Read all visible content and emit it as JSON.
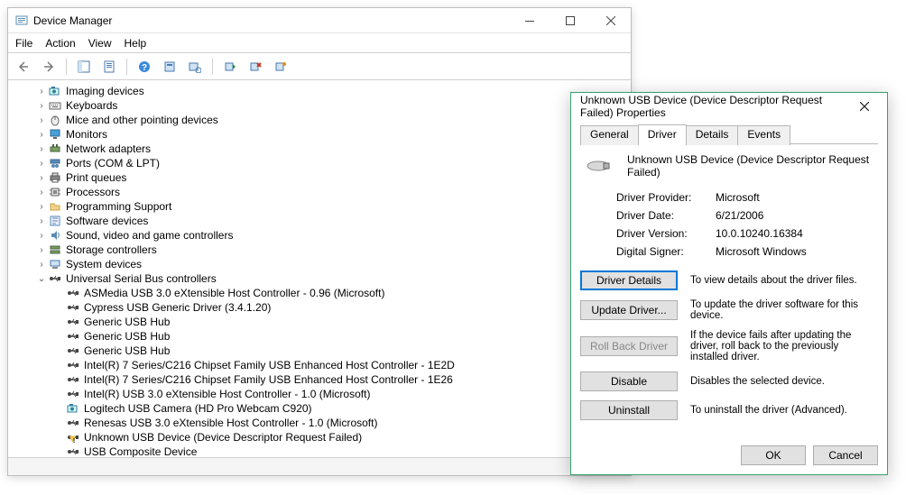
{
  "devmgr": {
    "title": "Device Manager",
    "menu": {
      "file": "File",
      "action": "Action",
      "view": "View",
      "help": "Help"
    },
    "tree": [
      {
        "indent": 1,
        "chev": ">",
        "icon": "camera",
        "label": "Imaging devices"
      },
      {
        "indent": 1,
        "chev": ">",
        "icon": "keyboard",
        "label": "Keyboards"
      },
      {
        "indent": 1,
        "chev": ">",
        "icon": "mouse",
        "label": "Mice and other pointing devices"
      },
      {
        "indent": 1,
        "chev": ">",
        "icon": "monitor",
        "label": "Monitors"
      },
      {
        "indent": 1,
        "chev": ">",
        "icon": "network",
        "label": "Network adapters"
      },
      {
        "indent": 1,
        "chev": ">",
        "icon": "ports",
        "label": "Ports (COM & LPT)"
      },
      {
        "indent": 1,
        "chev": ">",
        "icon": "printer",
        "label": "Print queues"
      },
      {
        "indent": 1,
        "chev": ">",
        "icon": "cpu",
        "label": "Processors"
      },
      {
        "indent": 1,
        "chev": ">",
        "icon": "folder",
        "label": "Programming Support"
      },
      {
        "indent": 1,
        "chev": ">",
        "icon": "software",
        "label": "Software devices"
      },
      {
        "indent": 1,
        "chev": ">",
        "icon": "sound",
        "label": "Sound, video and game controllers"
      },
      {
        "indent": 1,
        "chev": ">",
        "icon": "storage",
        "label": "Storage controllers"
      },
      {
        "indent": 1,
        "chev": ">",
        "icon": "computer",
        "label": "System devices"
      },
      {
        "indent": 1,
        "chev": "v",
        "icon": "usb",
        "label": "Universal Serial Bus controllers"
      },
      {
        "indent": 2,
        "chev": "",
        "icon": "usb",
        "label": "ASMedia USB 3.0 eXtensible Host Controller - 0.96 (Microsoft)"
      },
      {
        "indent": 2,
        "chev": "",
        "icon": "usb",
        "label": "Cypress USB Generic Driver (3.4.1.20)"
      },
      {
        "indent": 2,
        "chev": "",
        "icon": "usb",
        "label": "Generic USB Hub"
      },
      {
        "indent": 2,
        "chev": "",
        "icon": "usb",
        "label": "Generic USB Hub"
      },
      {
        "indent": 2,
        "chev": "",
        "icon": "usb",
        "label": "Generic USB Hub"
      },
      {
        "indent": 2,
        "chev": "",
        "icon": "usb",
        "label": "Intel(R) 7 Series/C216 Chipset Family USB Enhanced Host Controller - 1E2D"
      },
      {
        "indent": 2,
        "chev": "",
        "icon": "usb",
        "label": "Intel(R) 7 Series/C216 Chipset Family USB Enhanced Host Controller - 1E26"
      },
      {
        "indent": 2,
        "chev": "",
        "icon": "usb",
        "label": "Intel(R) USB 3.0 eXtensible Host Controller - 1.0 (Microsoft)"
      },
      {
        "indent": 2,
        "chev": "",
        "icon": "camera",
        "label": "Logitech USB Camera (HD Pro Webcam C920)"
      },
      {
        "indent": 2,
        "chev": "",
        "icon": "usb",
        "label": "Renesas USB 3.0 eXtensible Host Controller - 1.0 (Microsoft)"
      },
      {
        "indent": 2,
        "chev": "",
        "icon": "usbwarn",
        "label": "Unknown USB Device (Device Descriptor Request Failed)"
      },
      {
        "indent": 2,
        "chev": "",
        "icon": "usb",
        "label": "USB Composite Device"
      }
    ]
  },
  "prop": {
    "title": "Unknown USB Device (Device Descriptor Request Failed) Properties",
    "tabs": {
      "general": "General",
      "driver": "Driver",
      "details": "Details",
      "events": "Events"
    },
    "device_name": "Unknown USB Device (Device Descriptor Request Failed)",
    "fields": {
      "provider_k": "Driver Provider:",
      "provider_v": "Microsoft",
      "date_k": "Driver Date:",
      "date_v": "6/21/2006",
      "version_k": "Driver Version:",
      "version_v": "10.0.10240.16384",
      "signer_k": "Digital Signer:",
      "signer_v": "Microsoft Windows"
    },
    "buttons": {
      "details": "Driver Details",
      "update": "Update Driver...",
      "rollback": "Roll Back Driver",
      "disable": "Disable",
      "uninstall": "Uninstall"
    },
    "descriptions": {
      "details": "To view details about the driver files.",
      "update": "To update the driver software for this device.",
      "rollback": "If the device fails after updating the driver, roll back to the previously installed driver.",
      "disable": "Disables the selected device.",
      "uninstall": "To uninstall the driver (Advanced)."
    },
    "footer": {
      "ok": "OK",
      "cancel": "Cancel"
    }
  }
}
